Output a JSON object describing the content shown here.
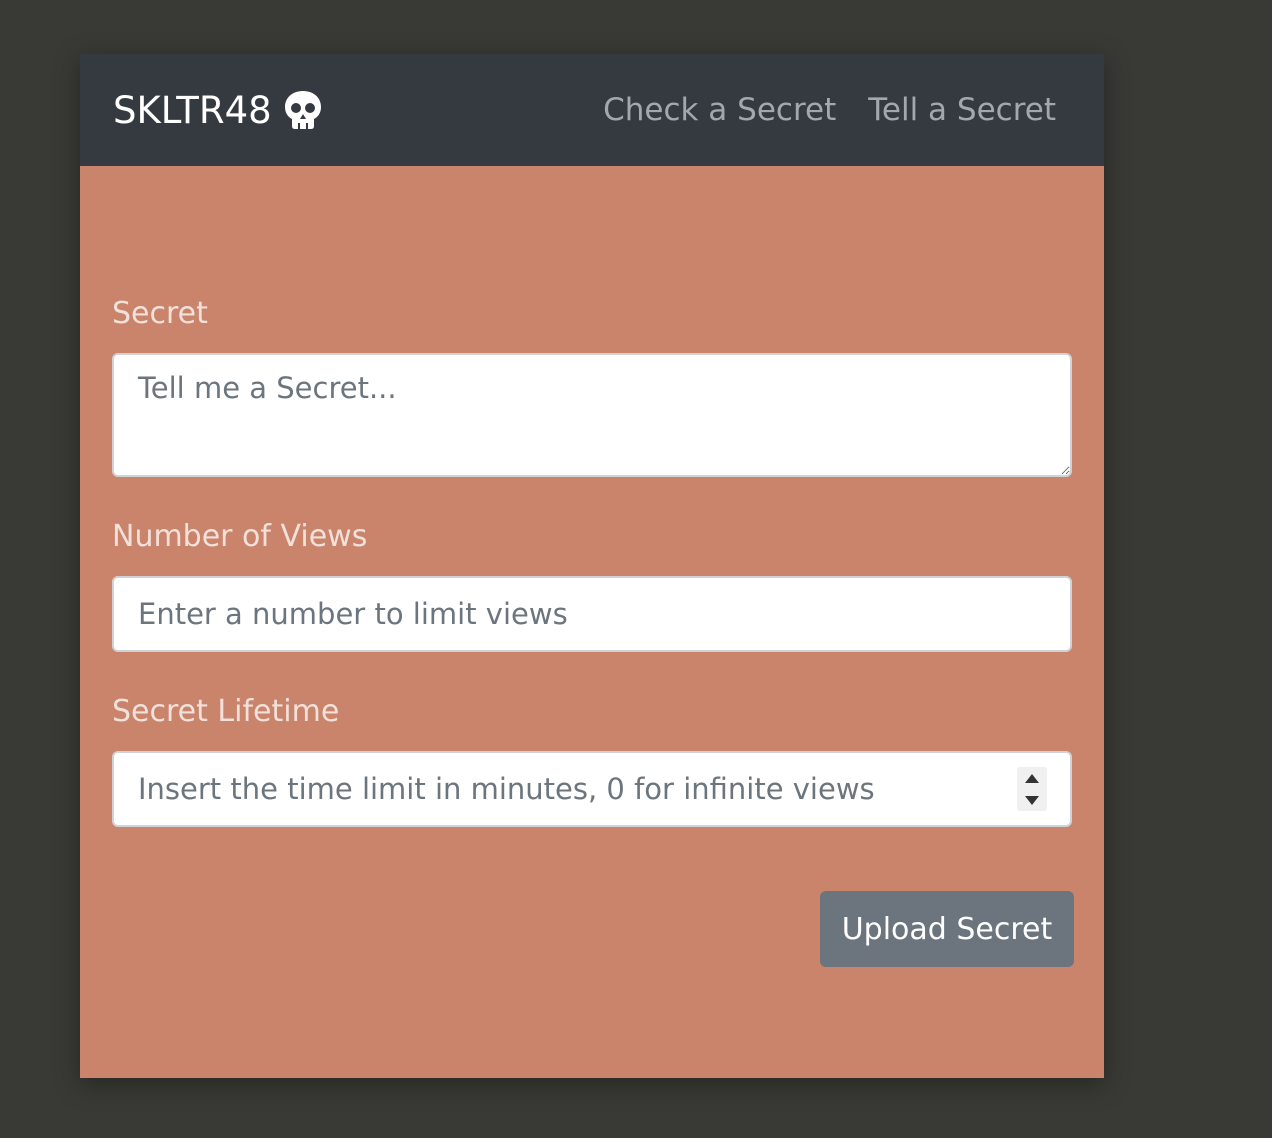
{
  "navbar": {
    "brand": "SKLTR48",
    "brand_icon": "skull-icon",
    "links": [
      {
        "label": "Check a Secret"
      },
      {
        "label": "Tell a Secret"
      }
    ]
  },
  "form": {
    "secret": {
      "label": "Secret",
      "placeholder": "Tell me a Secret...",
      "value": ""
    },
    "views": {
      "label": "Number of Views",
      "placeholder": "Enter a number to limit views",
      "value": ""
    },
    "lifetime": {
      "label": "Secret Lifetime",
      "placeholder": "Insert the time limit in minutes, 0 for infinite views",
      "value": ""
    },
    "submit_label": "Upload Secret"
  },
  "colors": {
    "page_background": "#393a35",
    "card_background": "#c9846b",
    "navbar_background": "#343a40",
    "button_background": "#6c757d"
  }
}
